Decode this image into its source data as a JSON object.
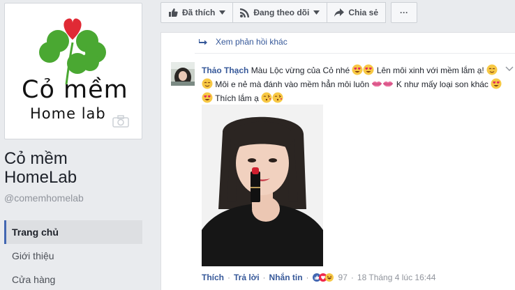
{
  "page": {
    "logo_title": "Cỏ mềm",
    "logo_subtitle": "Home lab",
    "name_line1": "Cỏ mềm",
    "name_line2": "HomeLab",
    "handle": "@comemhomelab"
  },
  "nav": {
    "items": [
      {
        "label": "Trang chủ",
        "active": true
      },
      {
        "label": "Giới thiệu",
        "active": false
      },
      {
        "label": "Cửa hàng",
        "active": false
      }
    ]
  },
  "actions": {
    "liked": "Đã thích",
    "following": "Đang theo dõi",
    "share": "Chia sẻ",
    "more": "···"
  },
  "thread": {
    "more_replies": "Xem phản hồi khác",
    "comment": {
      "author": "Thảo Thạch",
      "text_1": "Màu Lộc vừng của Cỏ nhé",
      "text_2": "Lên môi xinh với mềm lắm ạ!",
      "text_3": "Môi e nẻ mà đánh vào mềm hẳn môi luôn",
      "text_4": "K như mấy loại son khác",
      "text_5": "Thích lắm ạ",
      "like": "Thích",
      "reply": "Trả lời",
      "message": "Nhắn tin",
      "reaction_count": "97",
      "timestamp": "18 Tháng 4 lúc 16:44"
    }
  },
  "colors": {
    "brand_blue": "#4267b2",
    "link_blue": "#365899",
    "leaf_green": "#4aa832",
    "heart_red": "#e02a35"
  },
  "icons": [
    "thumbs-up-icon",
    "rss-icon",
    "share-arrow-icon",
    "caret-down-icon",
    "reply-arrow-icon",
    "camera-icon",
    "heart-eyes-emoji",
    "smiling-emoji",
    "kiss-lips-emoji",
    "kiss-face-emoji",
    "like-reaction-icon",
    "love-reaction-icon",
    "haha-reaction-icon"
  ]
}
